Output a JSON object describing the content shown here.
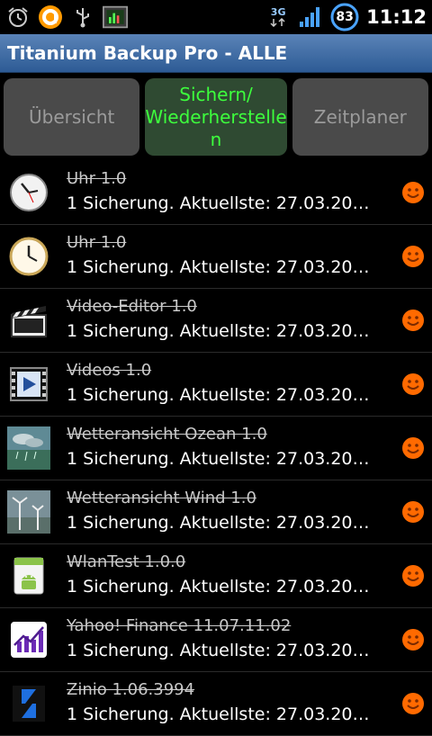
{
  "statusbar": {
    "network_label": "3G",
    "battery_level": "83",
    "time": "11:12",
    "icons": [
      "alarm-icon",
      "browser-icon",
      "usb-icon",
      "monitor-app-icon",
      "network-3g-icon",
      "signal-icon",
      "battery-icon"
    ]
  },
  "header": {
    "title": "Titanium Backup Pro - ALLE"
  },
  "tabs": [
    {
      "label": "Übersicht",
      "active": false
    },
    {
      "label": "Sichern/\nWiederherstelle\nn",
      "active": true
    },
    {
      "label": "Zeitplaner",
      "active": false
    }
  ],
  "apps": [
    {
      "name": "Uhr 1.0",
      "info": "1 Sicherung. Aktuellste: 27.03.20…",
      "icon": "clock-icon"
    },
    {
      "name": "Uhr 1.0",
      "info": "1 Sicherung. Aktuellste: 27.03.20…",
      "icon": "clock-icon"
    },
    {
      "name": "Video-Editor 1.0",
      "info": "1 Sicherung. Aktuellste: 27.03.20…",
      "icon": "clapperboard-icon"
    },
    {
      "name": "Videos 1.0",
      "info": "1 Sicherung. Aktuellste: 27.03.20…",
      "icon": "video-player-icon"
    },
    {
      "name": "Wetteransicht Ozean 1.0",
      "info": "1 Sicherung. Aktuellste: 27.03.20…",
      "icon": "weather-ocean-icon"
    },
    {
      "name": "Wetteransicht Wind 1.0",
      "info": "1 Sicherung. Aktuellste: 27.03.20…",
      "icon": "weather-wind-icon"
    },
    {
      "name": "WlanTest 1.0.0",
      "info": "1 Sicherung. Aktuellste: 27.03.20…",
      "icon": "android-icon"
    },
    {
      "name": "Yahoo! Finance 11.07.11.02",
      "info": "1 Sicherung. Aktuellste: 27.03.20…",
      "icon": "yahoo-finance-icon"
    },
    {
      "name": "Zinio 1.06.3994",
      "info": "1 Sicherung. Aktuellste: 27.03.20…",
      "icon": "zinio-icon"
    }
  ],
  "colors": {
    "title_bar": "#3d6aa5",
    "active_tab_text": "#3dff3d",
    "status_smiley": "#ff6a00"
  }
}
